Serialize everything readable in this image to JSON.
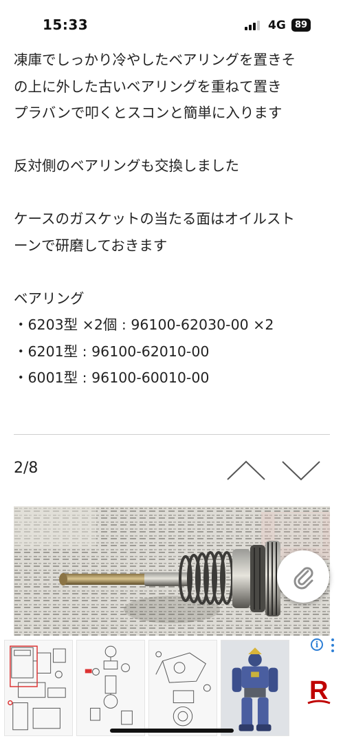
{
  "status_bar": {
    "time": "15:33",
    "network": "4G",
    "battery": "89"
  },
  "article": {
    "lines": [
      "凍庫でしっかり冷やしたベアリングを置きそ",
      "の上に外した古いベアリングを重ねて置き",
      "プラバンで叩くとスコンと簡単に入ります",
      "反対側のベアリングも交換しました",
      "ケースのガスケットの当たる面はオイルスト",
      "ーンで研磨しておきます",
      "ベアリング",
      "・6203型 ×2個 : 96100-62030-00 ×2",
      "・6201型 : 96100-62010-00",
      "・6001型 : 96100-60010-00"
    ]
  },
  "pager": {
    "indicator": "2/8",
    "prev_icon": "chevron-up-icon",
    "next_icon": "chevron-down-icon"
  },
  "photo": {
    "subject_icon": "shaft-gear-photo",
    "overlay_icon": "paperclip-icon"
  },
  "ad": {
    "info_icon": "i",
    "more_icon": "more-vertical-icon",
    "logo_letter": "R",
    "logo_color": "#bf0000"
  },
  "colors": {
    "text": "#222222",
    "divider": "#cfcfcf",
    "accent": "#2d7fd6"
  }
}
